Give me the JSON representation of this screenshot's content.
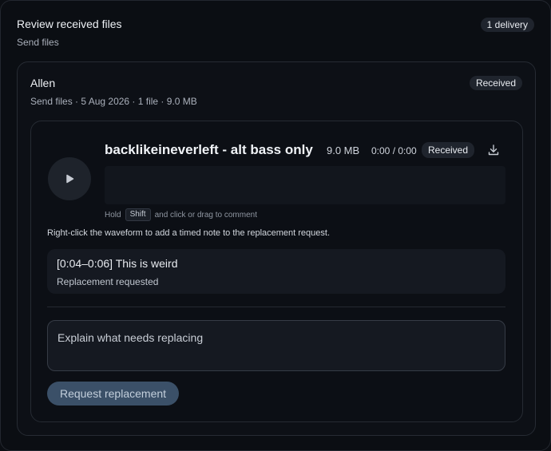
{
  "header": {
    "title": "Review received files",
    "subtitle": "Send files",
    "badge": "1 delivery"
  },
  "card": {
    "name": "Allen",
    "meta": "Send files · 5 Aug 2026 · 1 file · 9.0 MB",
    "status": "Received"
  },
  "track": {
    "title": "backlikeineverleft - alt bass only",
    "size": "9.0 MB",
    "time": "0:00 / 0:00",
    "status": "Received",
    "hint_prefix": "Hold",
    "hint_key": "Shift",
    "hint_suffix": "and click or drag to comment"
  },
  "instruction": "Right-click the waveform to add a timed note to the replacement request.",
  "note": {
    "text": "[0:04–0:06] This is weird",
    "status": "Replacement requested"
  },
  "request": {
    "placeholder": "Explain what needs replacing",
    "button_label": "Request replacement"
  },
  "icons": {
    "play": "play-icon",
    "download": "download-icon"
  }
}
